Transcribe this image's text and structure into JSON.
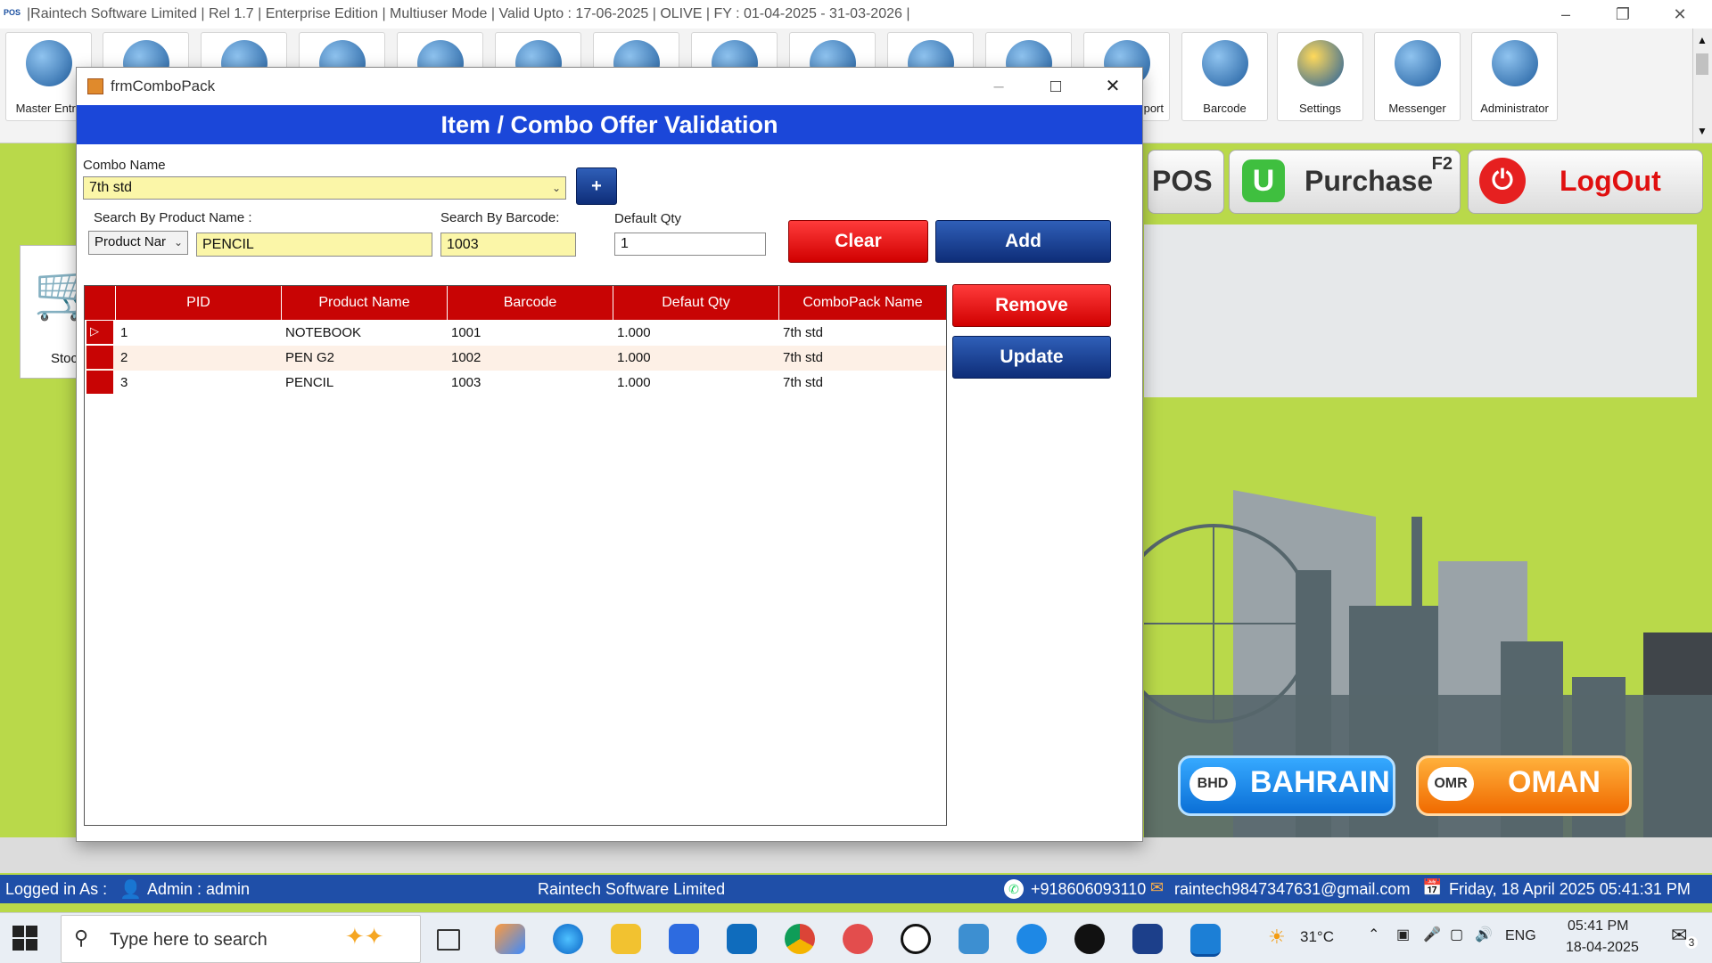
{
  "app": {
    "title": "|Raintech Software Limited |  Rel 1.7  |  Enterprise Edition  |  Multiuser Mode  |  Valid Upto : 17-06-2025  |  OLIVE  |  FY : 01-04-2025  -  31-03-2026  |",
    "logo": "POS"
  },
  "ribbon": {
    "master_label": "Master Entry",
    "export_label": "port",
    "barcode_label": "Barcode",
    "settings_label": "Settings",
    "messenger_label": "Messenger",
    "administrator_label": "Administrator"
  },
  "background": {
    "pos_label": "POS",
    "purchase_label": "Purchase",
    "purchase_shortcut": "F2",
    "logout_label": "LogOut",
    "stock_label": "Stoc",
    "bahrain_code": "BHD",
    "bahrain_label": "BAHRAIN",
    "oman_code": "OMR",
    "oman_label": "OMAN"
  },
  "dialog": {
    "window_title": "frmComboPack",
    "header": "Item /  Combo Offer Validation",
    "combo_name_label": "Combo Name",
    "combo_name_value": "7th std",
    "add_combo_label": "+",
    "search_product_label": "Search By Product Name :",
    "search_type_value": "Product Nar",
    "product_name_value": "PENCIL",
    "search_barcode_label": "Search By Barcode:",
    "barcode_value": "1003",
    "default_qty_label": "Default Qty",
    "default_qty_value": "1",
    "clear_label": "Clear",
    "add_label": "Add",
    "remove_label": "Remove",
    "update_label": "Update",
    "columns": [
      "PID",
      "Product Name",
      "Barcode",
      "Defaut Qty",
      "ComboPack Name"
    ],
    "rows": [
      [
        "1",
        "NOTEBOOK",
        "1001",
        "1.000",
        "7th std"
      ],
      [
        "2",
        "PEN G2",
        "1002",
        "1.000",
        "7th std"
      ],
      [
        "3",
        "PENCIL",
        "1003",
        "1.000",
        "7th std"
      ]
    ]
  },
  "statusbar": {
    "logged_in_label": "Logged in As :",
    "user": "Admin  :  admin",
    "company": "Raintech Software Limited",
    "phone": "+918606093110",
    "email": "raintech9847347631@gmail.com",
    "datetime": "Friday, 18 April 2025 05:41:31 PM"
  },
  "taskbar": {
    "search_placeholder": "Type here to search",
    "temperature": "31°C",
    "language": "ENG",
    "time": "05:41 PM",
    "date": "18-04-2025",
    "notification_count": "3"
  }
}
